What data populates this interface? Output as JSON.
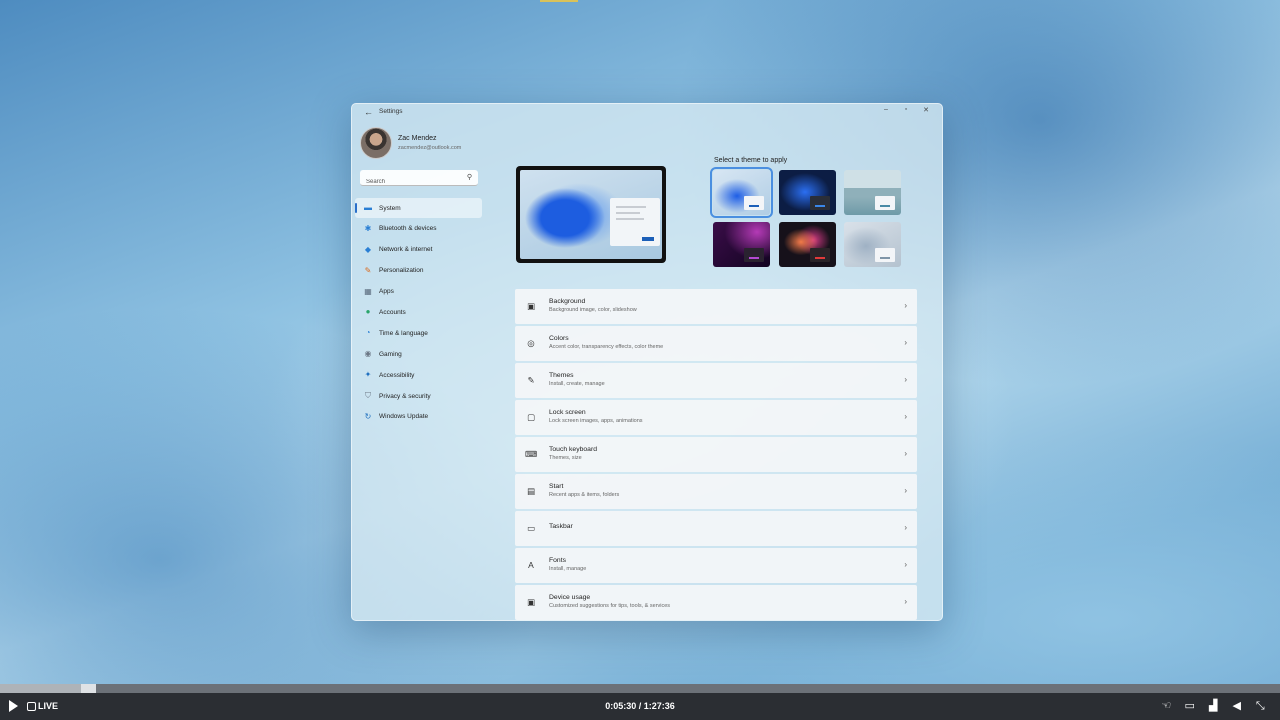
{
  "window": {
    "title": "Settings",
    "back": "←",
    "controls": {
      "minimize": "–",
      "maximize": "▫",
      "close": "✕"
    }
  },
  "user": {
    "name": "Zac Mendez",
    "email": "zacmendez@outlook.com"
  },
  "search": {
    "placeholder": "Search",
    "icon": "⚲"
  },
  "nav": [
    {
      "label": "System",
      "icon": "▬",
      "color": "#2a7fd4",
      "active": true
    },
    {
      "label": "Bluetooth & devices",
      "icon": "✱",
      "color": "#2a7fd4"
    },
    {
      "label": "Network & internet",
      "icon": "◆",
      "color": "#2a7fd4"
    },
    {
      "label": "Personalization",
      "icon": "✎",
      "color": "#d96a1e"
    },
    {
      "label": "Apps",
      "icon": "▦",
      "color": "#5a6b7d"
    },
    {
      "label": "Accounts",
      "icon": "●",
      "color": "#2aa56b"
    },
    {
      "label": "Time & language",
      "icon": "◔",
      "color": "#2a7fd4"
    },
    {
      "label": "Gaming",
      "icon": "◉",
      "color": "#6b7785"
    },
    {
      "label": "Accessibility",
      "icon": "✦",
      "color": "#1f6fbf"
    },
    {
      "label": "Privacy & security",
      "icon": "⛉",
      "color": "#6b7785"
    },
    {
      "label": "Windows Update",
      "icon": "↻",
      "color": "#1f6fbf"
    }
  ],
  "themes": {
    "heading": "Select a theme to apply"
  },
  "settings": [
    {
      "title": "Background",
      "subtitle": "Background image, color, slideshow",
      "icon": "▣"
    },
    {
      "title": "Colors",
      "subtitle": "Accent color, transparency effects, color theme",
      "icon": "◎"
    },
    {
      "title": "Themes",
      "subtitle": "Install, create, manage",
      "icon": "✎"
    },
    {
      "title": "Lock screen",
      "subtitle": "Lock screen images, apps, animations",
      "icon": "▢"
    },
    {
      "title": "Touch keyboard",
      "subtitle": "Themes, size",
      "icon": "⌨"
    },
    {
      "title": "Start",
      "subtitle": "Recent apps & items, folders",
      "icon": "▤"
    },
    {
      "title": "Taskbar",
      "subtitle": "",
      "icon": "▭"
    },
    {
      "title": "Fonts",
      "subtitle": "Install, manage",
      "icon": "A"
    },
    {
      "title": "Device usage",
      "subtitle": "Customized suggestions for tips, tools, & services",
      "icon": "▣"
    }
  ],
  "player": {
    "live_label": "LIVE",
    "time": "0:05:30 / 1:27:36",
    "progress": 0.063,
    "icons": {
      "sign_language": "☜",
      "cast": "▭",
      "quality": "▟",
      "volume": "◀",
      "expand": "⤡"
    }
  }
}
